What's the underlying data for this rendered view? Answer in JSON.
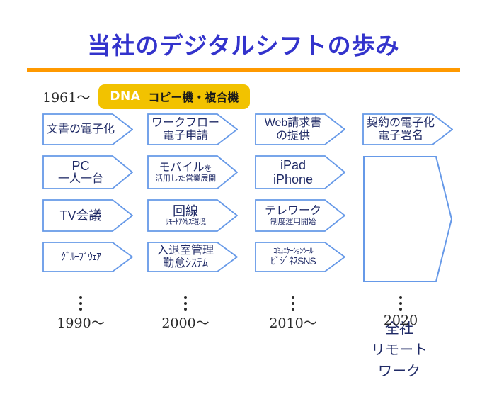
{
  "slide": {
    "title": "当社のデジタルシフトの歩み",
    "accent_color": "#ff9900",
    "title_color": "#3333cc",
    "chevron_border_color": "#6699e8",
    "chevron_text_color": "#1f2a66",
    "badge_color": "#f2c200"
  },
  "era_header": {
    "year": "1961〜",
    "badge_tag": "DNA",
    "badge_text": "コピー機・複合機"
  },
  "columns": [
    {
      "year": "1990〜",
      "items": [
        {
          "line1": "文書の電子化",
          "line2": ""
        },
        {
          "line1": "PC",
          "line2": "一人一台"
        },
        {
          "line1": "TV会議",
          "line2": ""
        },
        {
          "line1": "ｸﾞﾙｰﾌﾟｳｪｱ",
          "line2": ""
        }
      ]
    },
    {
      "year": "2000〜",
      "items": [
        {
          "line1": "ワークフロー",
          "line2": "電子申請"
        },
        {
          "line1": "モバイル",
          "line1_suffix": "を",
          "line2": "活用した営業展開"
        },
        {
          "line1": "回線",
          "line2": "ﾘﾓｰﾄｱｸｾｽ環境"
        },
        {
          "line1": "入退室管理",
          "line2": "勤怠ｼｽﾃﾑ"
        }
      ]
    },
    {
      "year": "2010〜",
      "items": [
        {
          "line1": "Web請求書",
          "line2": "の提供"
        },
        {
          "line1": "iPad",
          "line2": "iPhone"
        },
        {
          "line1": "テレワーク",
          "line2": "制度運用開始"
        },
        {
          "line1": "ｺﾐｭﾆｹｰｼｮﾝﾂｰﾙ",
          "line2": "ﾋﾞｼﾞﾈｽSNS"
        }
      ]
    },
    {
      "year": "2020",
      "items": [
        {
          "line1": "契約の電子化",
          "line2": "電子署名"
        }
      ],
      "highlight": {
        "line1": "全社",
        "line2": "リモート",
        "line3": "ワーク"
      }
    }
  ]
}
